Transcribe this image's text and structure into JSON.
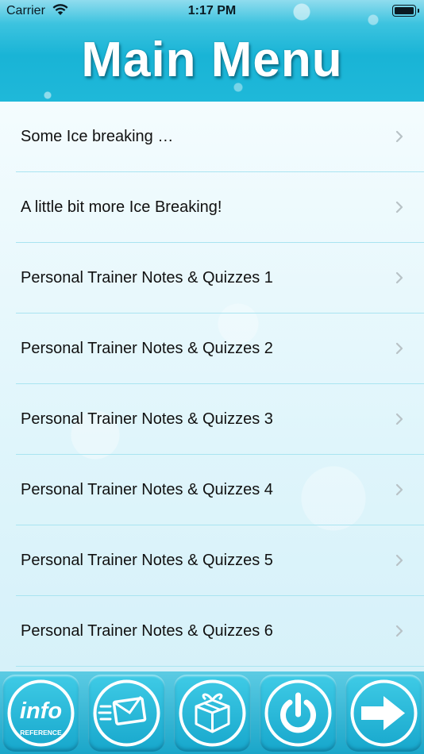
{
  "status": {
    "carrier": "Carrier",
    "time": "1:17 PM"
  },
  "header": {
    "title": "Main Menu"
  },
  "menu": {
    "items": [
      {
        "label": "Some Ice breaking …"
      },
      {
        "label": "A little bit more Ice Breaking!"
      },
      {
        "label": "Personal Trainer Notes & Quizzes 1"
      },
      {
        "label": "Personal Trainer Notes & Quizzes 2"
      },
      {
        "label": "Personal Trainer Notes & Quizzes 3"
      },
      {
        "label": "Personal Trainer Notes & Quizzes 4"
      },
      {
        "label": "Personal Trainer Notes & Quizzes 5"
      },
      {
        "label": "Personal Trainer Notes & Quizzes 6"
      }
    ]
  },
  "footer": {
    "info": {
      "big": "info",
      "small": "REFERENCE"
    }
  },
  "colors": {
    "accent": "#1fb8d9",
    "divider": "#a9e4f1",
    "chevron": "#b8c2c6"
  }
}
